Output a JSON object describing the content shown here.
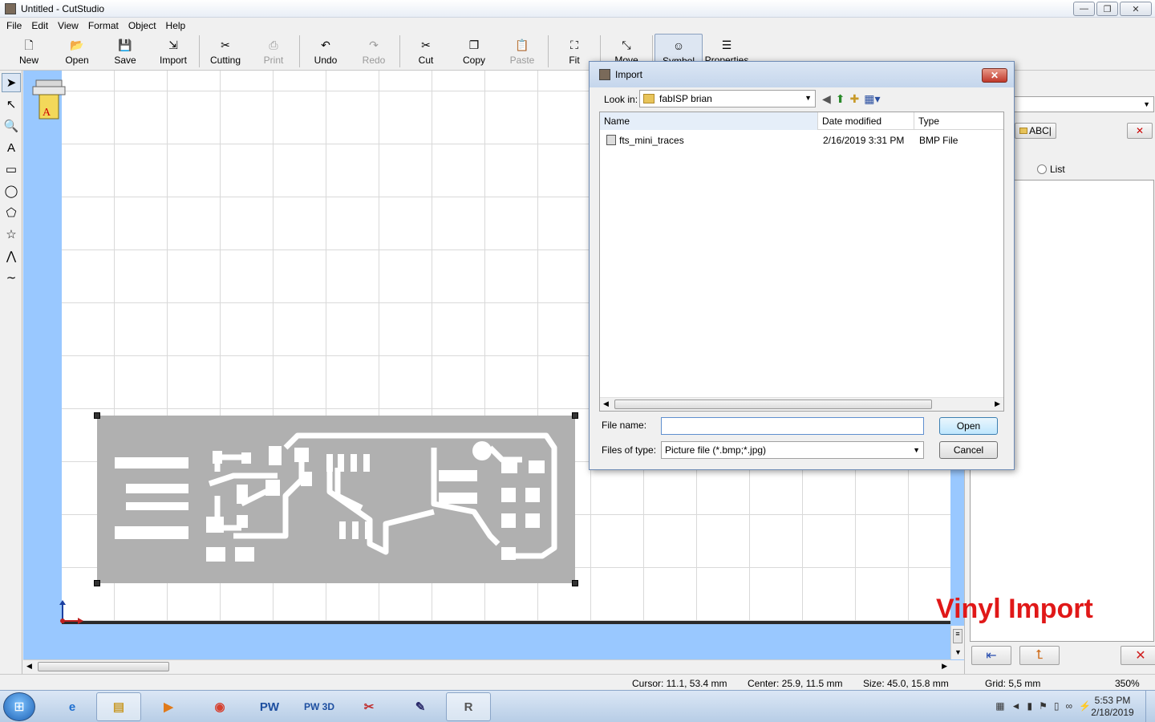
{
  "window": {
    "title": "Untitled - CutStudio",
    "controls": [
      "—",
      "❐",
      "✕"
    ]
  },
  "menu": [
    "File",
    "Edit",
    "View",
    "Format",
    "Object",
    "Help"
  ],
  "toolbar": [
    {
      "label": "New",
      "icon": "new-document-icon",
      "glyph": "🗋",
      "disabled": false
    },
    {
      "label": "Open",
      "icon": "open-folder-icon",
      "glyph": "📂",
      "disabled": false
    },
    {
      "label": "Save",
      "icon": "save-disk-icon",
      "glyph": "💾",
      "disabled": false
    },
    {
      "label": "Import",
      "icon": "import-icon",
      "glyph": "⇲",
      "disabled": false
    },
    {
      "label": "Cutting",
      "icon": "cutting-icon",
      "glyph": "✂",
      "disabled": false
    },
    {
      "label": "Print",
      "icon": "printer-icon",
      "glyph": "⎙",
      "disabled": true
    },
    {
      "label": "Undo",
      "icon": "undo-icon",
      "glyph": "↶",
      "disabled": false
    },
    {
      "label": "Redo",
      "icon": "redo-icon",
      "glyph": "↷",
      "disabled": true
    },
    {
      "label": "Cut",
      "icon": "scissors-icon",
      "glyph": "✂",
      "disabled": false
    },
    {
      "label": "Copy",
      "icon": "copy-icon",
      "glyph": "❐",
      "disabled": false
    },
    {
      "label": "Paste",
      "icon": "paste-icon",
      "glyph": "📋",
      "disabled": true
    },
    {
      "label": "Fit",
      "icon": "fit-icon",
      "glyph": "⛶",
      "disabled": false
    },
    {
      "label": "Move",
      "icon": "move-icon",
      "glyph": "⤡",
      "disabled": false
    },
    {
      "label": "Symbol",
      "icon": "symbol-icon",
      "glyph": "☺",
      "disabled": false
    },
    {
      "label": "Properties",
      "icon": "properties-icon",
      "glyph": "☰",
      "disabled": false
    }
  ],
  "left_tools": [
    {
      "name": "select-arrow-icon",
      "glyph": "➤"
    },
    {
      "name": "edit-node-icon",
      "glyph": "↖"
    },
    {
      "name": "zoom-icon",
      "glyph": "🔍"
    },
    {
      "name": "text-tool-icon",
      "glyph": "A"
    },
    {
      "name": "rectangle-tool-icon",
      "glyph": "▭"
    },
    {
      "name": "ellipse-tool-icon",
      "glyph": "◯"
    },
    {
      "name": "polygon-tool-icon",
      "glyph": "⬠"
    },
    {
      "name": "star-tool-icon",
      "glyph": "☆"
    },
    {
      "name": "polyline-tool-icon",
      "glyph": "⋀"
    },
    {
      "name": "curve-tool-icon",
      "glyph": "∼"
    }
  ],
  "right_panel": {
    "abc_label": "ABC|",
    "radio_label": "List"
  },
  "overlay_label": "Vinyl Import",
  "status": {
    "cursor": "Cursor: 11.1, 53.4 mm",
    "center": "Center: 25.9, 11.5 mm",
    "size": "Size: 45.0, 15.8 mm",
    "grid": "Grid: 5,5 mm",
    "zoom": "350%"
  },
  "dialog": {
    "title": "Import",
    "look_in_label": "Look in:",
    "look_in_value": "fabISP brian",
    "columns": {
      "name": "Name",
      "date": "Date modified",
      "type": "Type"
    },
    "files": [
      {
        "name": "fts_mini_traces",
        "date": "2/16/2019 3:31 PM",
        "type": "BMP File"
      }
    ],
    "file_name_label": "File name:",
    "file_name_value": "",
    "files_of_type_label": "Files of type:",
    "files_of_type_value": "Picture file (*.bmp;*.jpg)",
    "open_label": "Open",
    "cancel_label": "Cancel"
  },
  "taskbar": {
    "apps": [
      {
        "name": "internet-explorer-icon",
        "glyph": "e",
        "color": "#1e6fd0"
      },
      {
        "name": "file-explorer-icon",
        "glyph": "▤",
        "color": "#c89a2a"
      },
      {
        "name": "media-player-icon",
        "glyph": "▶",
        "color": "#e07a1a"
      },
      {
        "name": "chrome-icon",
        "glyph": "◉",
        "color": "#d6402f"
      },
      {
        "name": "pw-app-icon",
        "glyph": "PW",
        "color": "#1e4fa0"
      },
      {
        "name": "pw3d-app-icon",
        "glyph": "PW 3D",
        "color": "#1e4fa0"
      },
      {
        "name": "cutting-app-icon",
        "glyph": "✂",
        "color": "#c03030"
      },
      {
        "name": "notes-app-icon",
        "glyph": "✎",
        "color": "#2a2a6a"
      },
      {
        "name": "cutstudio-app-icon",
        "glyph": "R",
        "color": "#555555"
      }
    ],
    "time": "5:53 PM",
    "date": "2/18/2019"
  }
}
